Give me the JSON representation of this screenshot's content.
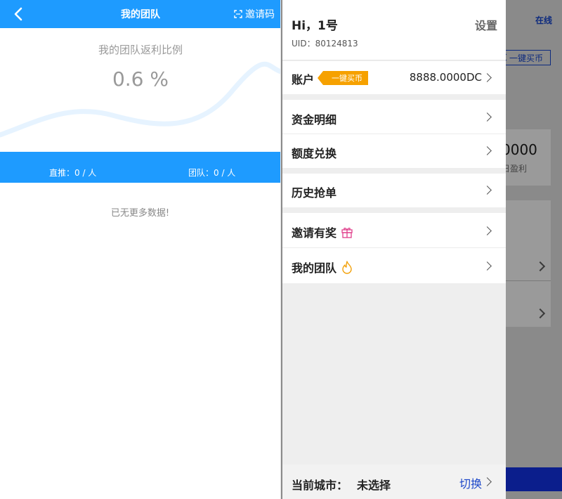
{
  "left": {
    "header": {
      "title": "我的团队",
      "invite_label": "邀请码"
    },
    "hero": {
      "ratio_label": "我的团队返利比例",
      "ratio_value": "0.6 %"
    },
    "stats": {
      "direct": "直推：0 / 人",
      "team": "团队：0 / 人"
    },
    "empty_text": "已无更多数据!"
  },
  "drawer": {
    "greeting": "Hi，1号",
    "uid": "UID：80124813",
    "settings_label": "设置",
    "account": {
      "label": "账户",
      "tag": "一键买币",
      "balance": "8888.0000DC"
    },
    "items": [
      {
        "label": "资金明细"
      },
      {
        "label": "额度兑换"
      },
      {
        "label": "历史抢单"
      },
      {
        "label": "邀请有奖"
      },
      {
        "label": "我的团队"
      }
    ],
    "city": {
      "label": "当前城市：",
      "value": "未选择",
      "switch_label": "切换"
    }
  },
  "background": {
    "online_label": "在线",
    "buy_label": "一键买币",
    "amount": "0000",
    "amount_sub": "日盈利"
  },
  "colors": {
    "primary_blue": "#1e9bff",
    "tag_orange": "#f6a100",
    "switch_blue": "#1b46c9",
    "gift_icon": "#e0408c",
    "fire_icon": "#f2a20d"
  }
}
